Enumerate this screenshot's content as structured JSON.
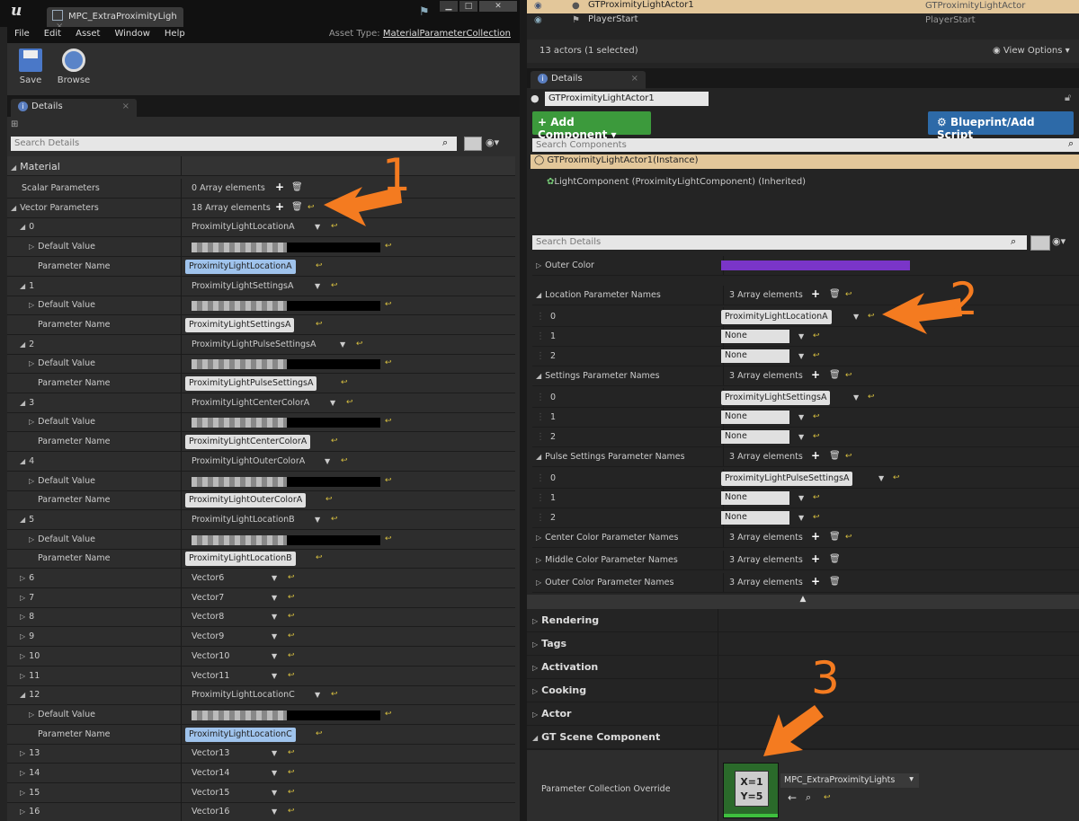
{
  "left": {
    "tab_title": "MPC_ExtraProximityLigh",
    "menus": [
      "File",
      "Edit",
      "Asset",
      "Window",
      "Help"
    ],
    "asset_type_label": "Asset Type:",
    "asset_type_value": "MaterialParameterCollection",
    "toolbar": {
      "save": "Save",
      "browse": "Browse"
    },
    "details_tab": "Details",
    "search_placeholder": "Search Details",
    "material_header": "Material",
    "scalar_params": {
      "label": "Scalar Parameters",
      "value": "0 Array elements"
    },
    "vector_params": {
      "label": "Vector Parameters",
      "value": "18 Array elements"
    },
    "default_value_label": "Default Value",
    "parameter_name_label": "Parameter Name",
    "vectors": [
      {
        "idx": "0",
        "name": "ProximityLightLocationA",
        "expanded": true
      },
      {
        "idx": "1",
        "name": "ProximityLightSettingsA",
        "expanded": true
      },
      {
        "idx": "2",
        "name": "ProximityLightPulseSettingsA",
        "expanded": true
      },
      {
        "idx": "3",
        "name": "ProximityLightCenterColorA",
        "expanded": true
      },
      {
        "idx": "4",
        "name": "ProximityLightOuterColorA",
        "expanded": true
      },
      {
        "idx": "5",
        "name": "ProximityLightLocationB",
        "expanded": true
      },
      {
        "idx": "6",
        "name": "Vector6",
        "expanded": false
      },
      {
        "idx": "7",
        "name": "Vector7",
        "expanded": false
      },
      {
        "idx": "8",
        "name": "Vector8",
        "expanded": false
      },
      {
        "idx": "9",
        "name": "Vector9",
        "expanded": false
      },
      {
        "idx": "10",
        "name": "Vector10",
        "expanded": false
      },
      {
        "idx": "11",
        "name": "Vector11",
        "expanded": false
      },
      {
        "idx": "12",
        "name": "ProximityLightLocationC",
        "expanded": true
      },
      {
        "idx": "13",
        "name": "Vector13",
        "expanded": false
      },
      {
        "idx": "14",
        "name": "Vector14",
        "expanded": false
      },
      {
        "idx": "15",
        "name": "Vector15",
        "expanded": false
      },
      {
        "idx": "16",
        "name": "Vector16",
        "expanded": false
      }
    ]
  },
  "right": {
    "outliner_rows": [
      {
        "name": "GTProximityLightActor1",
        "type": "GTProximityLightActor"
      },
      {
        "name": "PlayerStart",
        "type": "PlayerStart"
      }
    ],
    "actor_count": "13 actors (1 selected)",
    "view_options": "View Options",
    "details_tab": "Details",
    "actor_name": "GTProximityLightActor1",
    "add_component": "Add Component",
    "blueprint_script": "Blueprint/Add Script",
    "search_components": "Search Components",
    "instance_item": "GTProximityLightActor1(Instance)",
    "light_component": "LightComponent (ProximityLightComponent) (Inherited)",
    "search_details": "Search Details",
    "outer_color_label": "Outer Color",
    "outer_color_hex": "#7a35c8",
    "location_names": {
      "label": "Location Parameter Names",
      "value": "3 Array elements",
      "items": [
        "ProximityLightLocationA",
        "None",
        "None"
      ]
    },
    "settings_names": {
      "label": "Settings Parameter Names",
      "value": "3 Array elements",
      "items": [
        "ProximityLightSettingsA",
        "None",
        "None"
      ]
    },
    "pulse_names": {
      "label": "Pulse Settings Parameter Names",
      "value": "3 Array elements",
      "items": [
        "ProximityLightPulseSettingsA",
        "None",
        "None"
      ]
    },
    "center_names": {
      "label": "Center Color Parameter Names",
      "value": "3 Array elements"
    },
    "middle_names": {
      "label": "Middle Color Parameter Names",
      "value": "3 Array elements"
    },
    "outer_names": {
      "label": "Outer Color Parameter Names",
      "value": "3 Array elements"
    },
    "categories": [
      "Rendering",
      "Tags",
      "Activation",
      "Cooking",
      "Actor",
      "GT Scene Component"
    ],
    "pco_label": "Parameter Collection Override",
    "pco_value": "MPC_ExtraProximityLights",
    "thumb_text_1": "X=1",
    "thumb_text_2": "Y=5"
  },
  "annotations": {
    "a1": "1",
    "a2": "2",
    "a3": "3"
  },
  "accent": "#f47b20"
}
